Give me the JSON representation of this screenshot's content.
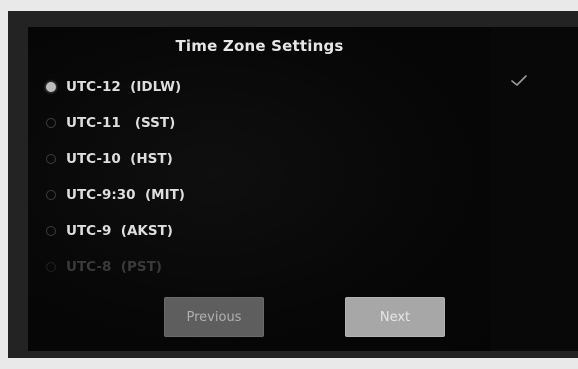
{
  "screen": {
    "title": "Time Zone Settings"
  },
  "timezones": [
    {
      "label": "UTC-12  (IDLW)",
      "selected": true
    },
    {
      "label": "UTC-11   (SST)",
      "selected": false
    },
    {
      "label": "UTC-10  (HST)",
      "selected": false
    },
    {
      "label": "UTC-9:30  (MIT)",
      "selected": false
    },
    {
      "label": "UTC-9  (AKST)",
      "selected": false
    },
    {
      "label": "UTC-8  (PST)",
      "selected": false
    }
  ],
  "buttons": {
    "previous": "Previous",
    "next": "Next"
  },
  "icons": {
    "confirm": "checkmark-icon",
    "radio": "radio-icon"
  },
  "colors": {
    "background": "#070707",
    "text": "#dedede",
    "previous_button": "#5e5e5e",
    "next_button": "#a7a7a7"
  }
}
